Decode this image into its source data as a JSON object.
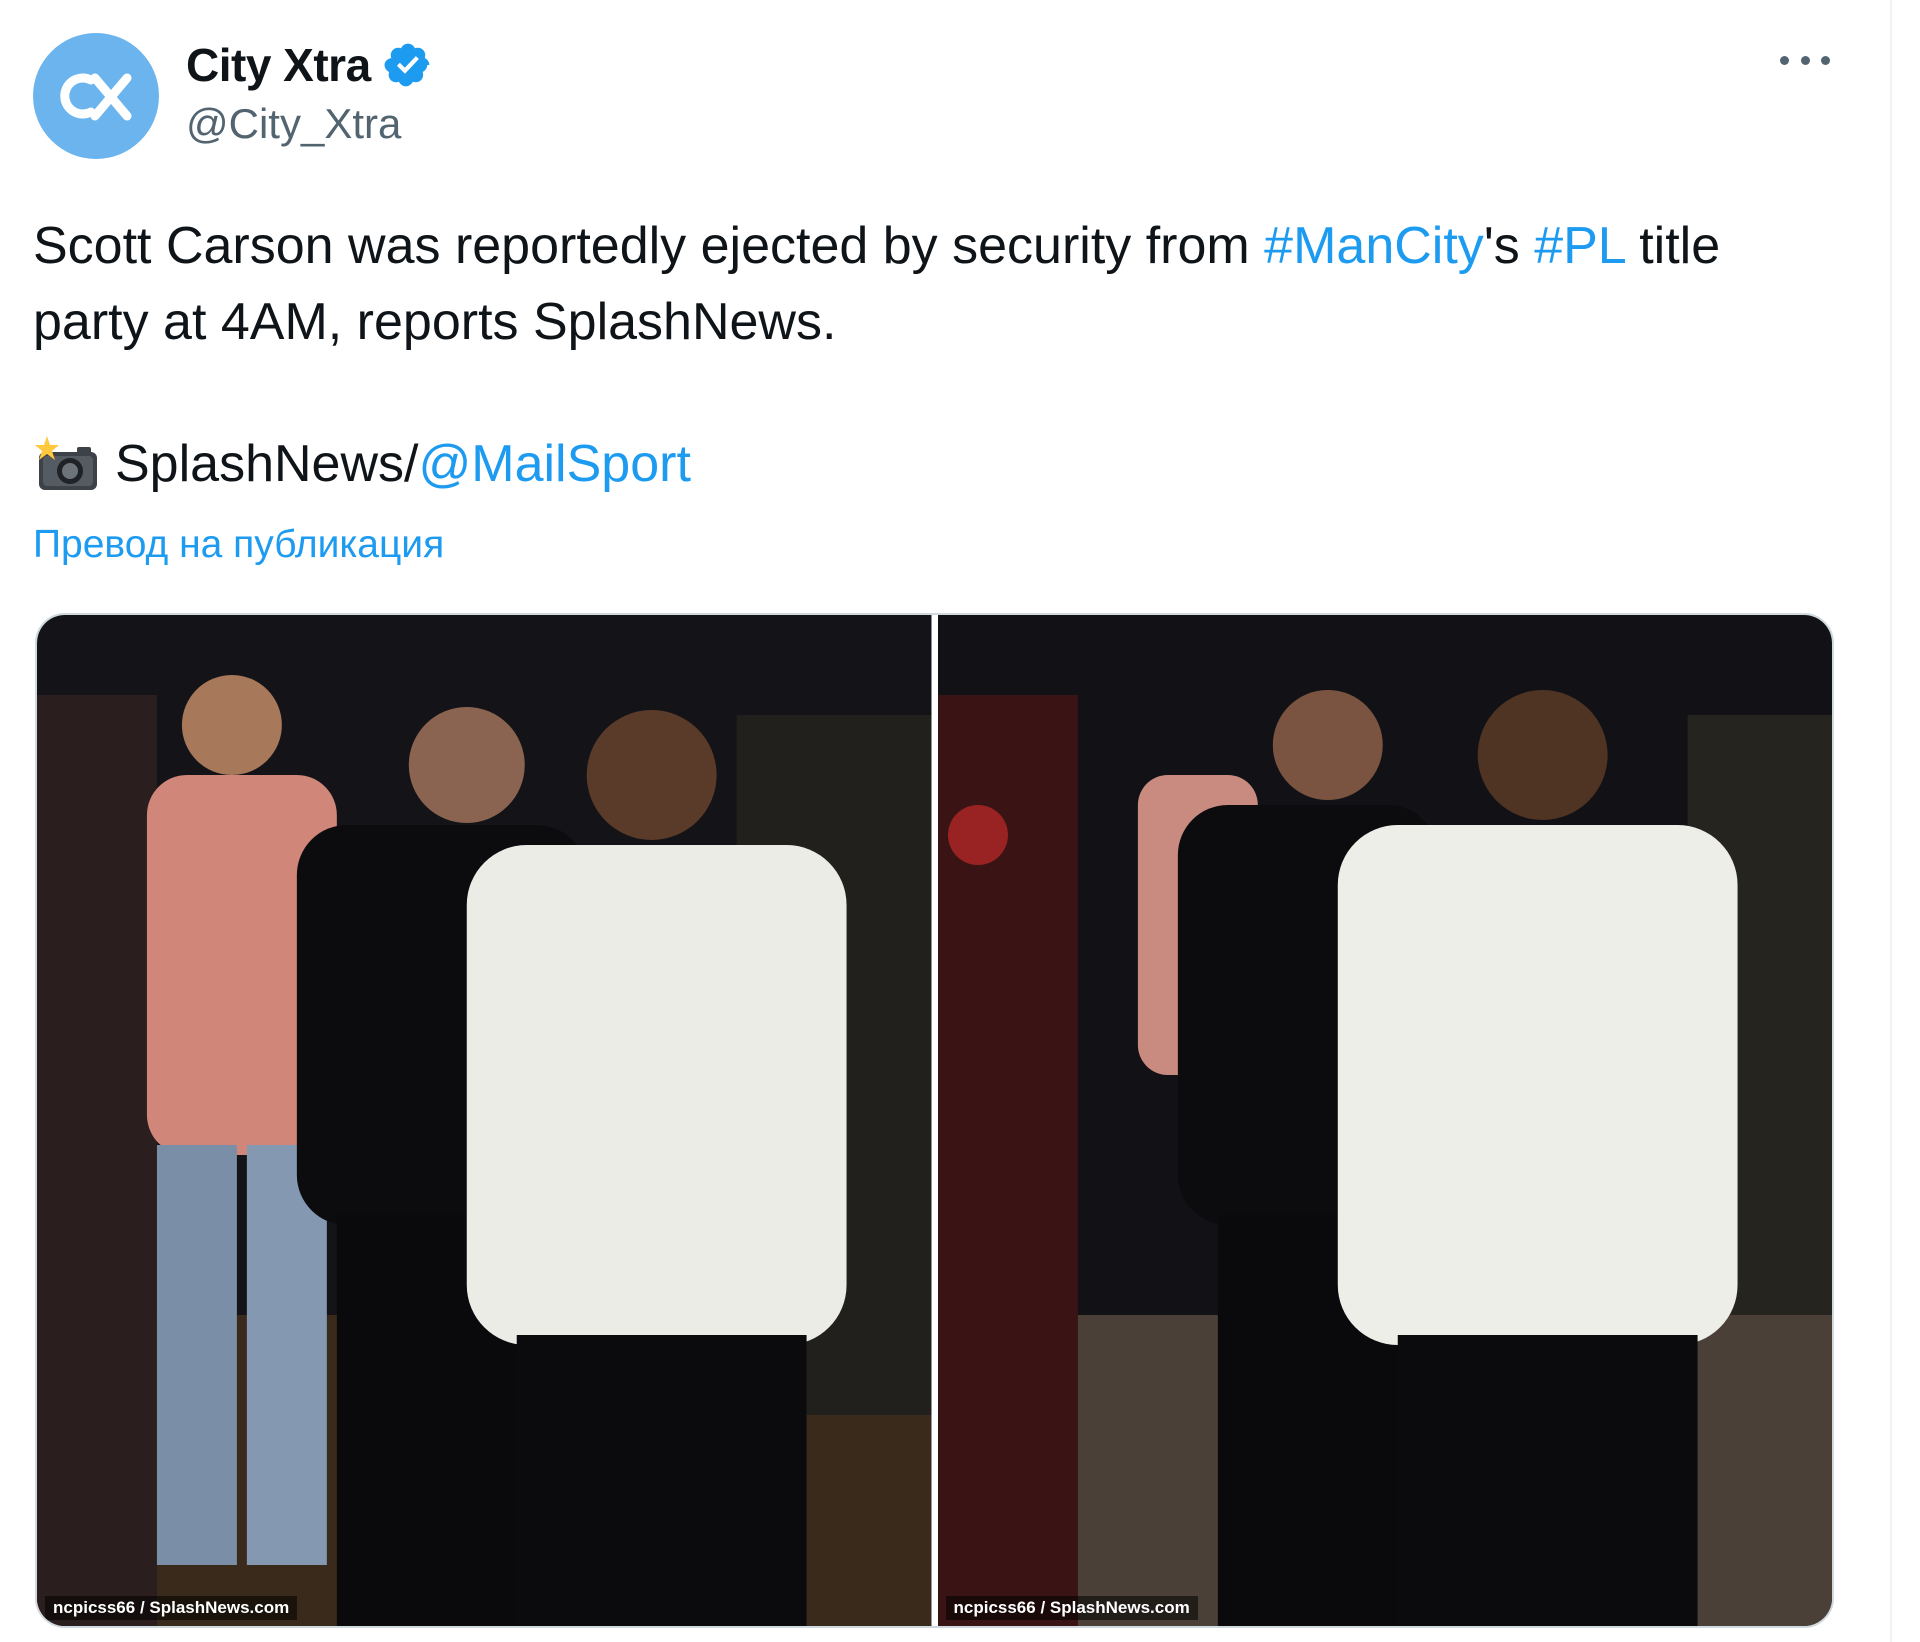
{
  "tweet": {
    "author": {
      "display_name": "City Xtra",
      "handle": "@City_Xtra",
      "verified": true,
      "avatar_icon": "city-xtra-logo-icon"
    },
    "more_icon": "more-options-icon",
    "text": {
      "part1": "Scott Carson was reportedly ejected by security from ",
      "hashtag1": "#ManCity",
      "part2": "'s ",
      "hashtag2": "#PL",
      "part3": " title party at 4AM, reports SplashNews."
    },
    "credit": {
      "emoji_icon": "camera-flash-icon",
      "source": "SplashNews/",
      "mention": "@MailSport"
    },
    "translate_label": "Превод на публикация",
    "media": [
      {
        "watermark": "ncpicss66 / SplashNews.com"
      },
      {
        "watermark": "ncpicss66 / SplashNews.com"
      }
    ]
  },
  "colors": {
    "link": "#1d9bf0",
    "text": "#0f1419",
    "secondary": "#536471",
    "avatar_bg": "#6cb4ee"
  }
}
